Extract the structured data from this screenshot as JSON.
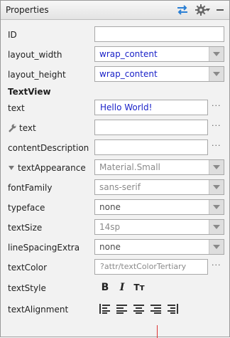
{
  "panel": {
    "title": "Properties",
    "icons": [
      "sync-arrows-icon",
      "gear-icon",
      "chevron-down-icon",
      "minimize-icon"
    ]
  },
  "rows": {
    "id": {
      "label": "ID",
      "value": ""
    },
    "layout_width": {
      "label": "layout_width",
      "value": "wrap_content"
    },
    "layout_height": {
      "label": "layout_height",
      "value": "wrap_content"
    },
    "section": {
      "label": "TextView"
    },
    "text": {
      "label": "text",
      "value": "Hello World!"
    },
    "tools_text": {
      "label": "text",
      "value": ""
    },
    "contentDescription": {
      "label": "contentDescription",
      "value": ""
    },
    "textAppearance": {
      "label": "textAppearance",
      "value": "Material.Small"
    },
    "fontFamily": {
      "label": "fontFamily",
      "value": "sans-serif"
    },
    "typeface": {
      "label": "typeface",
      "value": "none"
    },
    "textSize": {
      "label": "textSize",
      "value": "14sp"
    },
    "lineSpacingExtra": {
      "label": "lineSpacingExtra",
      "value": "none"
    },
    "textColor": {
      "label": "textColor",
      "value": "?attr/textColorTertiary"
    },
    "textStyle": {
      "label": "textStyle",
      "bold": "B",
      "italic": "I",
      "allcaps": "Tт"
    },
    "textAlignment": {
      "label": "textAlignment"
    }
  },
  "ellipsis": "···",
  "colors": {
    "value_blue": "#1a22c8",
    "value_gray": "#8a8a8a",
    "accent_blue": "#2a7fd4"
  }
}
